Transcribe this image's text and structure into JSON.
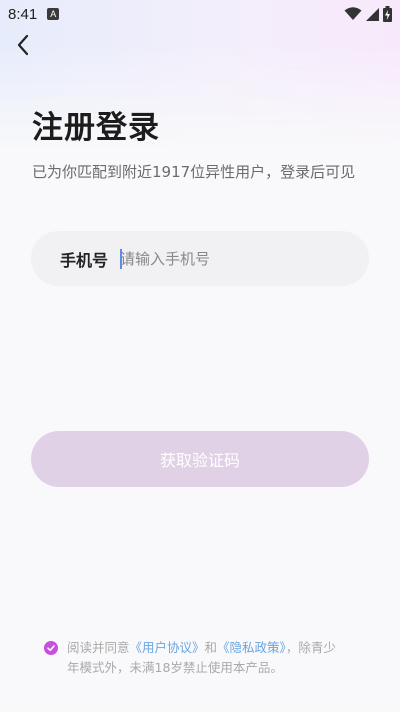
{
  "status_bar": {
    "time": "8:41",
    "notification_icon": "A",
    "icons": [
      "wifi-icon",
      "signal-icon",
      "battery-charging-icon"
    ]
  },
  "nav": {
    "back_icon": "back-arrow-icon"
  },
  "header": {
    "title": "注册登录",
    "subtitle": "已为你匹配到附近1917位异性用户，登录后可见"
  },
  "phone_field": {
    "label": "手机号",
    "value": "",
    "placeholder": "请输入手机号"
  },
  "code_button": {
    "label": "获取验证码",
    "enabled": false
  },
  "agreement": {
    "checked": true,
    "prefix": "阅读并同意",
    "user_agreement_link": "《用户协议》",
    "and": "和",
    "privacy_link": "《隐私政策》",
    "suffix": "，除青少年模式外，未满18岁禁止使用本产品。"
  },
  "colors": {
    "accent": "#c64fe0",
    "button_disabled": "#e1d1e6",
    "link": "#6aa5e0",
    "input_bg": "#f1f1f3"
  }
}
